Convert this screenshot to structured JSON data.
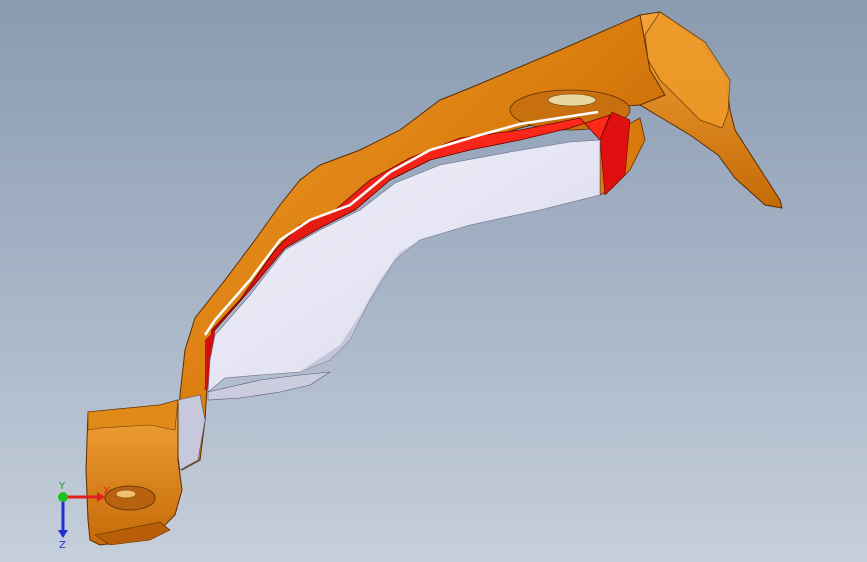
{
  "viewport": {
    "background_top": "#8a9bb0",
    "background_bottom": "#c6cfdb"
  },
  "model": {
    "flange_color": "#d97a0c",
    "flange_light": "#ee9a2a",
    "flange_dark": "#8a4a06",
    "red_face_color": "#e01010",
    "white_face_color": "#e8e8f6",
    "highlight_color": "#ffffff"
  },
  "triad": {
    "x_label": "X",
    "y_label": "Y",
    "z_label": "Z",
    "x_color": "#e02020",
    "y_color": "#20c020",
    "z_color": "#2030d0"
  }
}
